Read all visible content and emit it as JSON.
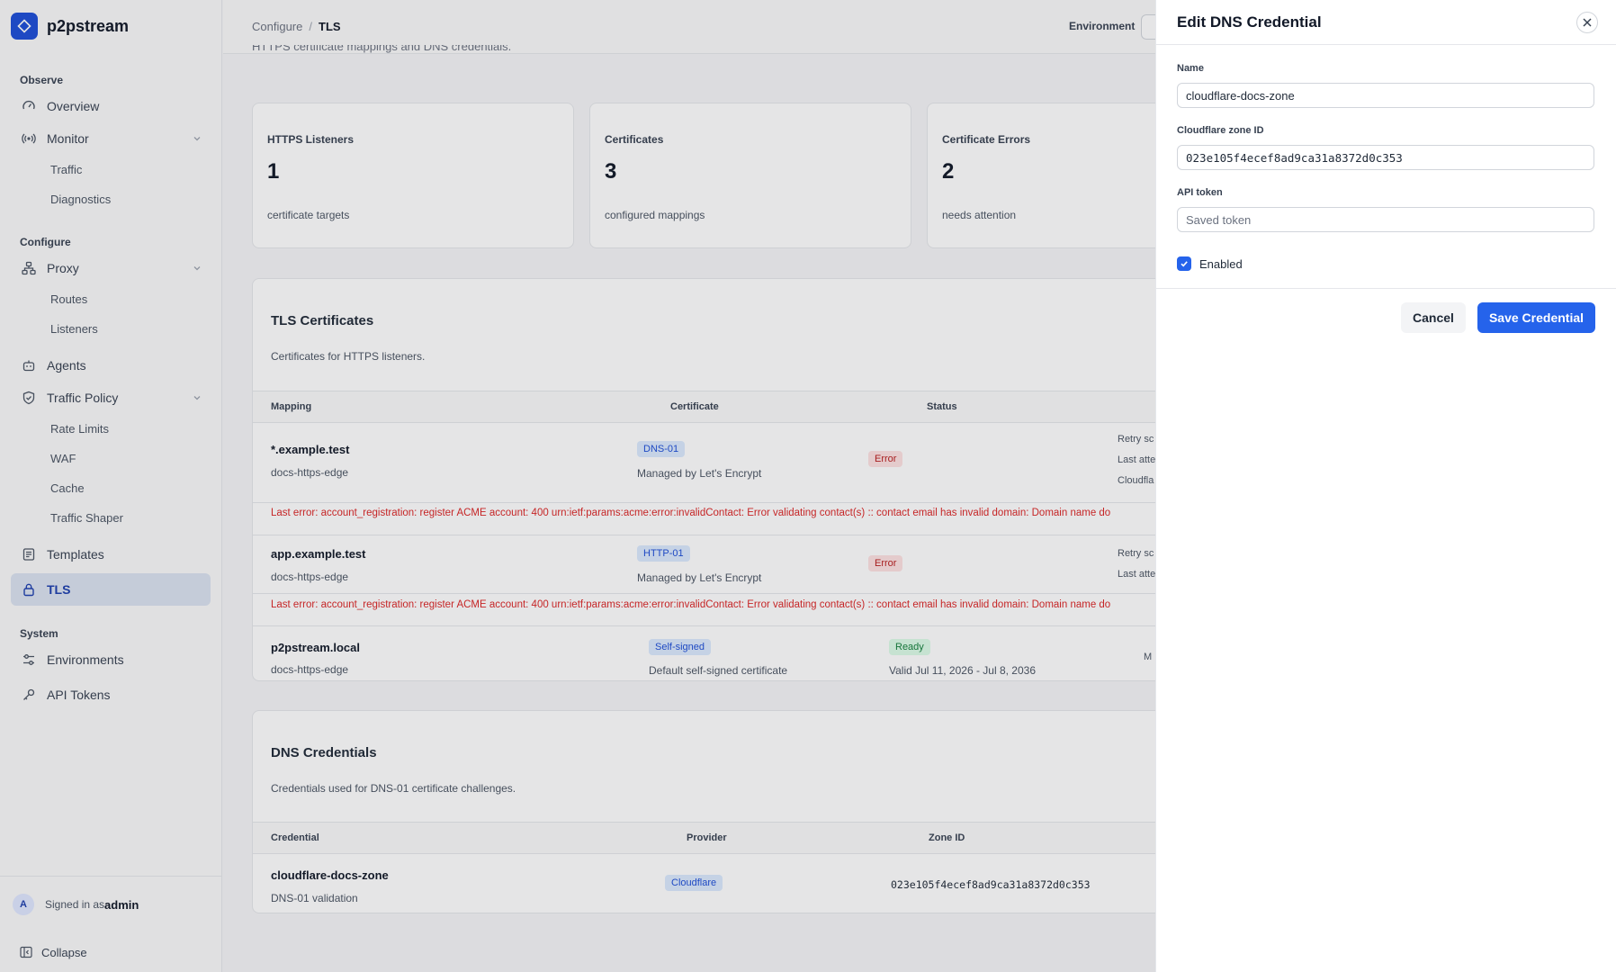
{
  "brand": {
    "name": "p2pstream"
  },
  "sidebar": {
    "sections": {
      "observe": "Observe",
      "configure": "Configure",
      "system": "System"
    },
    "items": {
      "overview": "Overview",
      "monitor": "Monitor",
      "traffic": "Traffic",
      "diagnostics": "Diagnostics",
      "proxy": "Proxy",
      "routes": "Routes",
      "listeners": "Listeners",
      "agents": "Agents",
      "traffic_policy": "Traffic Policy",
      "rate_limits": "Rate Limits",
      "waf": "WAF",
      "cache": "Cache",
      "traffic_shaper": "Traffic Shaper",
      "templates": "Templates",
      "tls": "TLS",
      "environments": "Environments",
      "api_tokens": "API Tokens"
    },
    "user": {
      "avatar": "A",
      "prefix": "Signed in as",
      "name": "admin"
    },
    "collapse": "Collapse"
  },
  "header": {
    "breadcrumb": {
      "parent": "Configure",
      "separator": "/",
      "current": "TLS"
    },
    "environment_label": "Environment",
    "page_subtitle": "HTTPS certificate mappings and DNS credentials."
  },
  "stats": [
    {
      "label": "HTTPS Listeners",
      "value": "1",
      "sub": "certificate targets"
    },
    {
      "label": "Certificates",
      "value": "3",
      "sub": "configured mappings"
    },
    {
      "label": "Certificate Errors",
      "value": "2",
      "sub": "needs attention"
    }
  ],
  "tls_certificates": {
    "title": "TLS Certificates",
    "description": "Certificates for HTTPS listeners.",
    "columns": {
      "mapping": "Mapping",
      "certificate": "Certificate",
      "status": "Status"
    },
    "rows": [
      {
        "name": "*.example.test",
        "listener": "docs-https-edge",
        "cert_type": "DNS-01",
        "cert_desc": "Managed by Let's Encrypt",
        "status": "Error",
        "notes": [
          "Retry sc",
          "Last atte",
          "Cloudfla"
        ],
        "error": "Last error: account_registration: register ACME account: 400 urn:ietf:params:acme:error:invalidContact: Error validating contact(s) :: contact email has invalid domain: Domain name do"
      },
      {
        "name": "app.example.test",
        "listener": "docs-https-edge",
        "cert_type": "HTTP-01",
        "cert_desc": "Managed by Let's Encrypt",
        "status": "Error",
        "notes": [
          "Retry sc",
          "Last atte"
        ],
        "error": "Last error: account_registration: register ACME account: 400 urn:ietf:params:acme:error:invalidContact: Error validating contact(s) :: contact email has invalid domain: Domain name do"
      },
      {
        "name": "p2pstream.local",
        "listener": "docs-https-edge",
        "cert_type": "Self-signed",
        "cert_desc": "Default self-signed certificate",
        "status": "Ready",
        "validity": "Valid Jul 11, 2026 - Jul 8, 2036",
        "notes": [
          "M"
        ]
      }
    ]
  },
  "dns_credentials": {
    "title": "DNS Credentials",
    "description": "Credentials used for DNS-01 certificate challenges.",
    "columns": {
      "credential": "Credential",
      "provider": "Provider",
      "zone_id": "Zone ID"
    },
    "rows": [
      {
        "name": "cloudflare-docs-zone",
        "desc": "DNS-01 validation",
        "provider": "Cloudflare",
        "zone_id": "023e105f4ecef8ad9ca31a8372d0c353"
      }
    ]
  },
  "drawer": {
    "title": "Edit DNS Credential",
    "name_label": "Name",
    "name_value": "cloudflare-docs-zone",
    "zone_label": "Cloudflare zone ID",
    "zone_value": "023e105f4ecef8ad9ca31a8372d0c353",
    "token_label": "API token",
    "token_placeholder": "Saved token",
    "enabled_label": "Enabled",
    "enabled": true,
    "cancel_label": "Cancel",
    "save_label": "Save Credential"
  },
  "colors": {
    "accent": "#2563eb",
    "active_nav_bg": "#dbe3f1",
    "error": "#dc2626",
    "ready": "#15803d"
  }
}
